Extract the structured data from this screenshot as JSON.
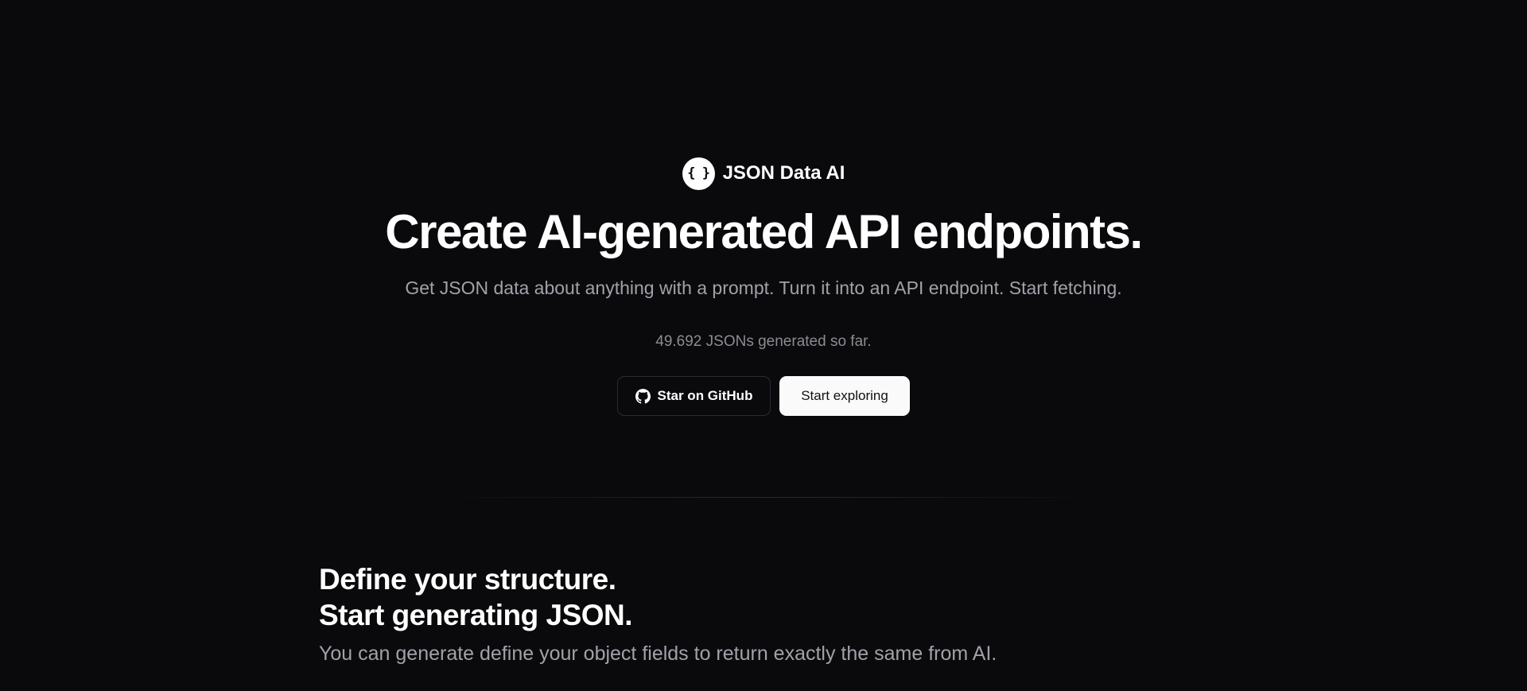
{
  "brand": {
    "logo_glyph": "{ }",
    "name": "JSON Data AI",
    "logo_icon": "curly-braces-icon"
  },
  "hero": {
    "title": "Create AI-generated API endpoints.",
    "subtitle": "Get JSON data about anything with a prompt. Turn it into an API endpoint. Start fetching.",
    "counter": "49.692 JSONs generated so far."
  },
  "actions": {
    "github_label": "Star on GitHub",
    "github_icon": "github-icon",
    "explore_label": "Start exploring"
  },
  "feature": {
    "title_line1": "Define your structure.",
    "title_line2": "Start generating JSON.",
    "description": "You can generate define your object fields to return exactly the same from AI."
  },
  "colors": {
    "background": "#0a0a0c",
    "text_primary": "#ffffff",
    "text_muted": "#a1a1aa",
    "button_light": "#fafafa"
  }
}
